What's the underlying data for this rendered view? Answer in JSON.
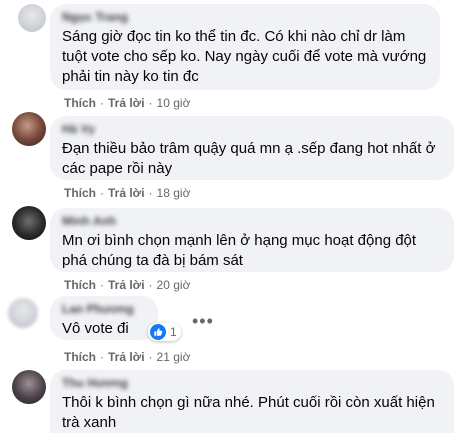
{
  "comments": [
    {
      "author": "Ngọc Trang",
      "text": "Sáng giờ đọc tin ko thể tin đc. Có khi nào chỉ dr làm tuột vote cho sếp ko. Nay ngày cuối để vote mà vướng phải tin này ko tin đc",
      "like": "Thích",
      "reply": "Trả lời",
      "time": "10 giờ"
    },
    {
      "author": "Hà Vy",
      "text": "Đạn thiều bảo trâm quậy quá mn ạ .sếp đang hot nhất ở các pape rồi này",
      "like": "Thích",
      "reply": "Trả lời",
      "time": "18 giờ"
    },
    {
      "author": "Minh Anh",
      "text": "Mn ơi bình chọn mạnh lên ở hạng mục hoạt động đột phá chúng ta đà bị bám sát",
      "like": "Thích",
      "reply": "Trả lời",
      "time": "20 giờ"
    },
    {
      "author": "Lan Phương",
      "text": "Vô vote đi",
      "like": "Thích",
      "reply": "Trả lời",
      "time": "21 giờ",
      "reaction_count": "1",
      "reaction_icon": "like-icon"
    },
    {
      "author": "Thu Hương",
      "text": "Thôi k bình chọn gì nữa nhé. Phút cuối rồi còn xuất hiện trà xanh"
    }
  ],
  "separator": "·",
  "more_icon": "more-options-icon",
  "colors": {
    "bubble": "#f0f2f5",
    "meta": "#65676b",
    "like_blue": "#1877f2"
  }
}
